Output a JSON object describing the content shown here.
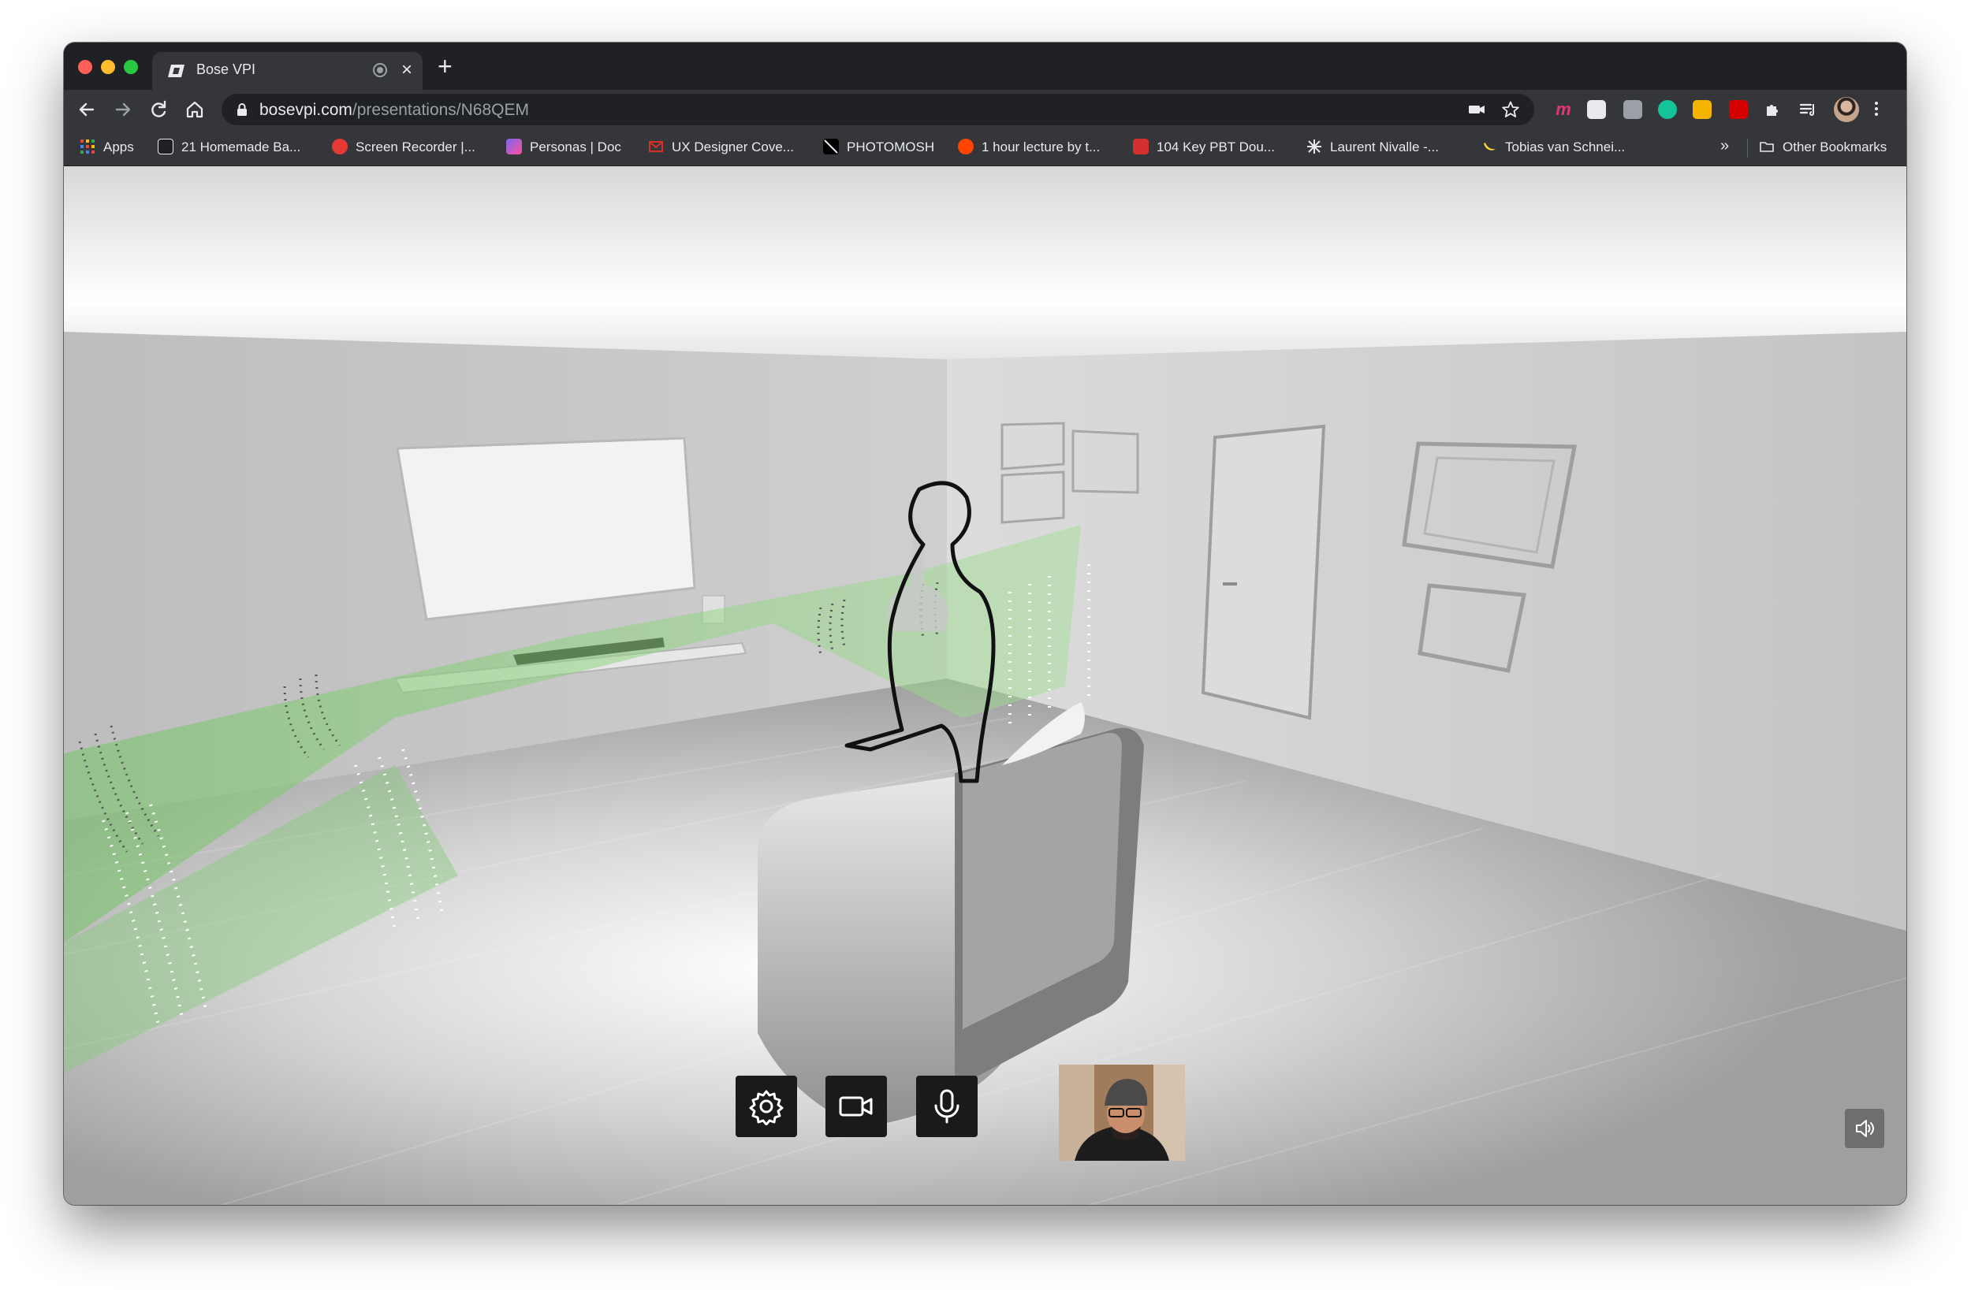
{
  "window": {
    "tab": {
      "title": "Bose VPI",
      "favicon": "bose-icon"
    },
    "new_tab_icon": "plus-icon"
  },
  "toolbar": {
    "url_domain": "bosevpi.com",
    "url_path": "/presentations/N68QEM",
    "icons": [
      "back-icon",
      "forward-icon",
      "reload-icon",
      "home-icon",
      "lock-icon",
      "camera-icon",
      "star-icon",
      "puzzle-icon",
      "reading-list-icon",
      "menu-icon"
    ]
  },
  "bookmarks": {
    "items": [
      {
        "label": "Apps",
        "icon": "apps-grid-icon",
        "color": "#e8453c"
      },
      {
        "label": "21 Homemade Ba...",
        "icon": "recipe-icon",
        "color": "#ffffff"
      },
      {
        "label": "Screen Recorder |...",
        "icon": "record-icon",
        "color": "#e53935"
      },
      {
        "label": "Personas | Doc",
        "icon": "clickup-icon",
        "color": "#7b68ee"
      },
      {
        "label": "UX Designer Cove...",
        "icon": "gmail-icon",
        "color": "#d93025"
      },
      {
        "label": "PHOTOMOSH",
        "icon": "photomosh-icon",
        "color": "#000000"
      },
      {
        "label": "1 hour lecture by t...",
        "icon": "reddit-icon",
        "color": "#ff4500"
      },
      {
        "label": "104 Key PBT Dou...",
        "icon": "keyboard-icon",
        "color": "#d32f2f"
      },
      {
        "label": "Laurent Nivalle -...",
        "icon": "star-burst-icon",
        "color": "#000000"
      },
      {
        "label": "Tobias van Schnei...",
        "icon": "banana-icon",
        "color": "#fdd835"
      }
    ],
    "overflow": "»",
    "other_bookmarks": "Other Bookmarks"
  },
  "controls": {
    "settings": "gear-icon",
    "camera": "video-camera-icon",
    "microphone": "microphone-icon",
    "volume": "speaker-icon"
  },
  "colors": {
    "accent_green": "#8fd68a",
    "control_bg": "#1a1a1a",
    "chrome_dark": "#202124",
    "chrome_toolbar": "#35363a"
  }
}
